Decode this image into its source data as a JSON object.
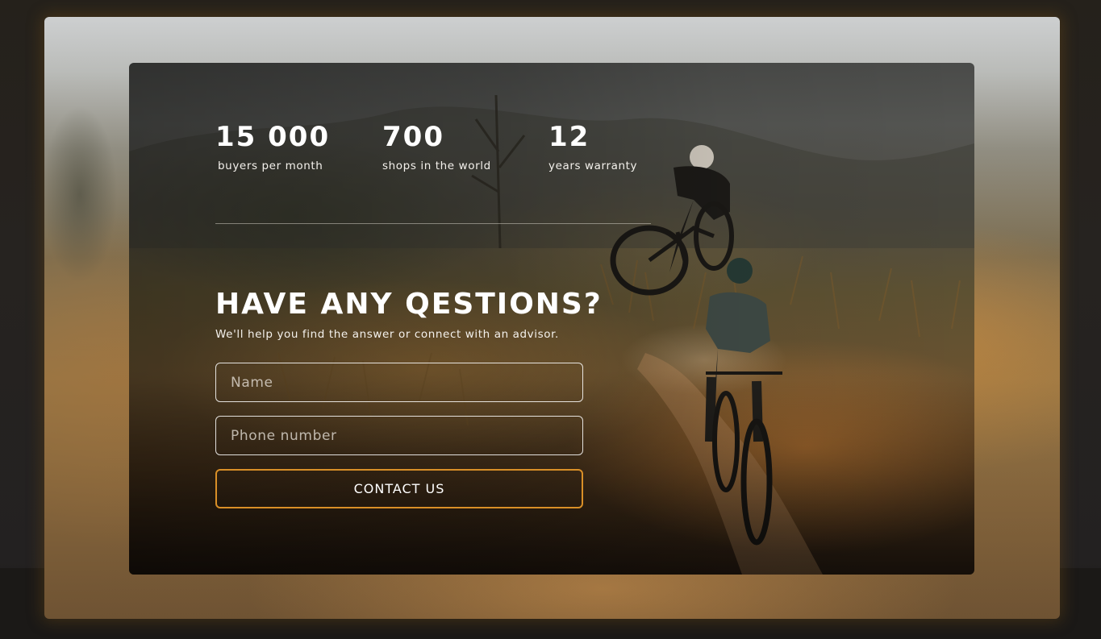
{
  "stats": [
    {
      "value": "15 000",
      "label": "buyers per month"
    },
    {
      "value": "700",
      "label": "shops in the world"
    },
    {
      "value": "12",
      "label": "years warranty"
    }
  ],
  "contact": {
    "heading": "HAVE ANY QESTIONS?",
    "subheading": "We'll help you find the answer or connect with an advisor.",
    "name_placeholder": "Name",
    "phone_placeholder": "Phone number",
    "submit_label": "CONTACT US"
  },
  "colors": {
    "accent": "#d98f27",
    "text": "#ffffff",
    "page_background": "#1f1c19"
  }
}
